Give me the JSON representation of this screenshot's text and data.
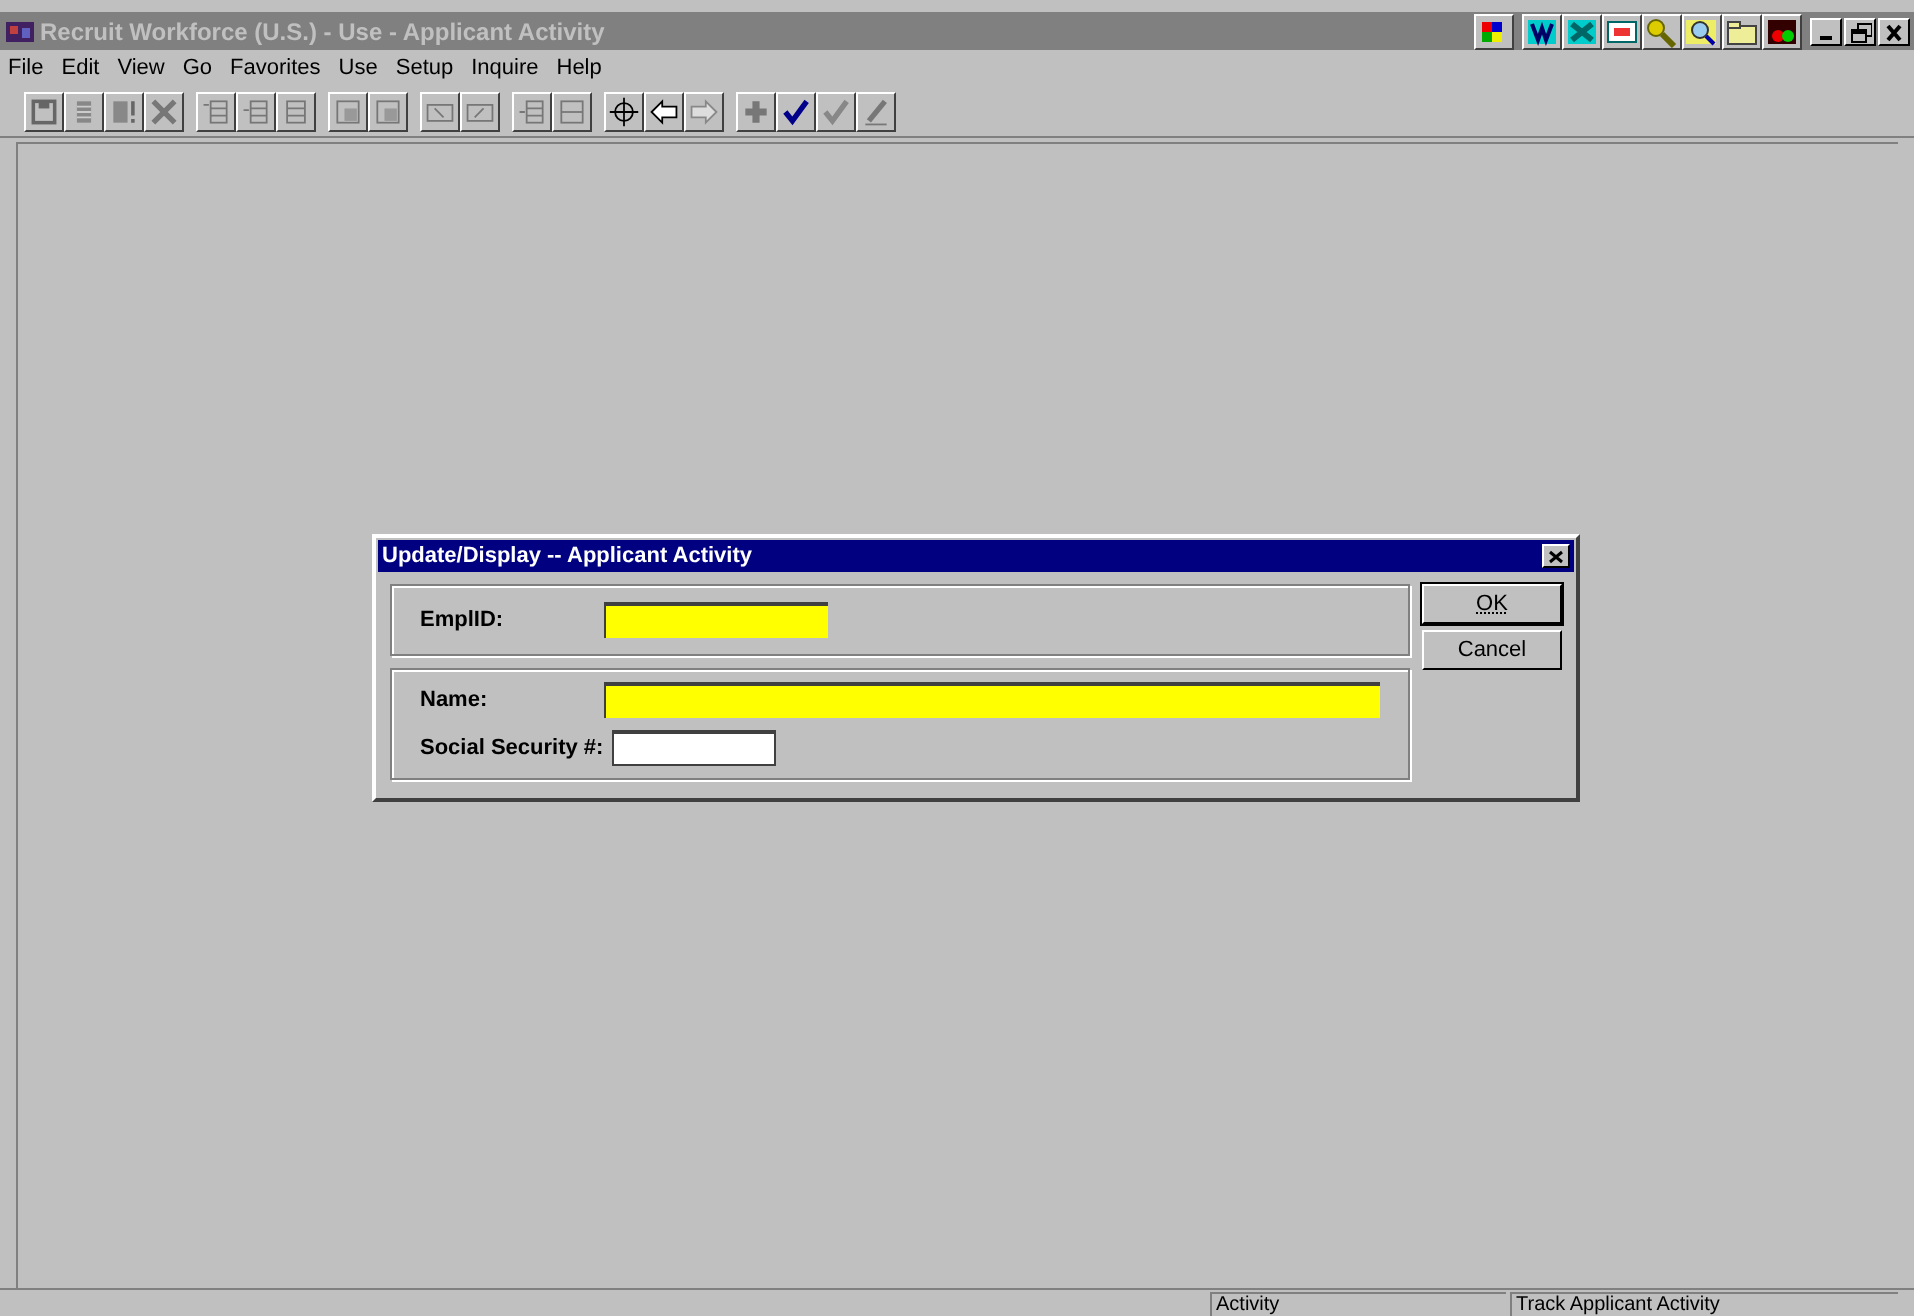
{
  "window": {
    "title": "Recruit Workforce (U.S.) - Use - Applicant Activity",
    "active": false
  },
  "menu": [
    "File",
    "Edit",
    "View",
    "Go",
    "Favorites",
    "Use",
    "Setup",
    "Inquire",
    "Help"
  ],
  "dialog": {
    "title": "Update/Display -- Applicant Activity",
    "groups": [
      {
        "fields": [
          {
            "label": "EmplID:",
            "required": true,
            "kind": "short"
          }
        ]
      },
      {
        "fields": [
          {
            "label": "Name:",
            "required": true,
            "kind": "long"
          },
          {
            "label": "Social Security #:",
            "required": false,
            "kind": "small"
          }
        ]
      }
    ],
    "buttons": [
      {
        "label": "OK",
        "default": true
      },
      {
        "label": "Cancel",
        "default": false
      }
    ]
  },
  "status_bar": [
    "Activity",
    "Track  Applicant Activity"
  ]
}
